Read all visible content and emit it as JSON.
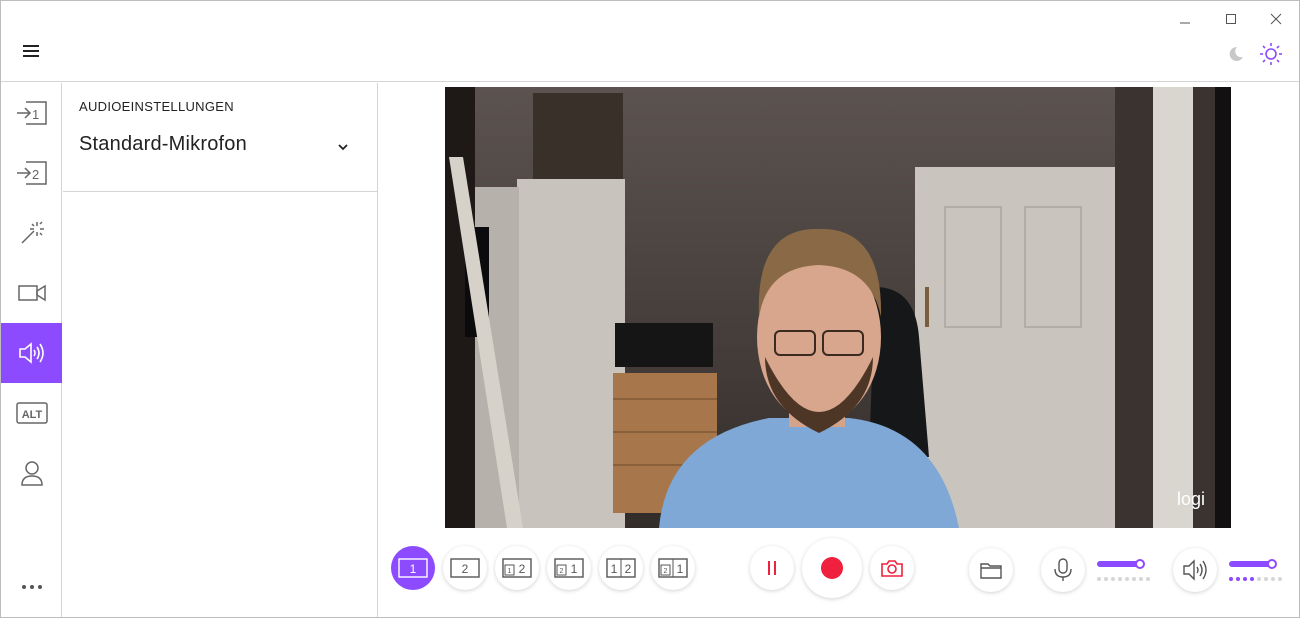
{
  "titlebar": {
    "minimize": "minimize-icon",
    "maximize": "maximize-icon",
    "close": "close-icon",
    "menu": "hamburger-icon",
    "theme_dark": "moon-icon",
    "theme_light": "sun-icon"
  },
  "sidebar": {
    "items": [
      {
        "icon": "source-1-icon",
        "label": "1"
      },
      {
        "icon": "source-2-icon",
        "label": "2"
      },
      {
        "icon": "magic-wand-icon"
      },
      {
        "icon": "camera-icon"
      },
      {
        "icon": "speaker-icon",
        "active": true
      },
      {
        "icon": "alt-icon",
        "label": "ALT"
      },
      {
        "icon": "user-icon"
      }
    ],
    "more": "more-icon"
  },
  "panel": {
    "title": "AUDIOEINSTELLUNGEN",
    "microphone": "Standard-Mikrofon"
  },
  "video": {
    "watermark": "logi"
  },
  "controls": {
    "layouts": [
      {
        "name": "layout-single-1",
        "label": "1"
      },
      {
        "name": "layout-single-2",
        "label": "2"
      },
      {
        "name": "layout-pip-1-2",
        "label": "2",
        "small": "1"
      },
      {
        "name": "layout-pip-2-1",
        "label": "1",
        "small": "2"
      },
      {
        "name": "layout-split-1-2",
        "left": "1",
        "right": "2"
      },
      {
        "name": "layout-split-2-1",
        "left": "1",
        "right": "2",
        "small": "2"
      }
    ],
    "pause": "pause-icon",
    "record": "record-icon",
    "snapshot": "camera-snapshot-icon",
    "folder": "folder-icon",
    "mic": "microphone-icon",
    "speaker": "speaker-icon",
    "mic_level": 1.0,
    "speaker_level": 1.0,
    "mic_meter_active": 0,
    "speaker_meter_active": 4,
    "meter_dots": 8
  },
  "colors": {
    "accent": "#8c4bff",
    "record": "#f0213e",
    "border": "#d4d4d4"
  }
}
